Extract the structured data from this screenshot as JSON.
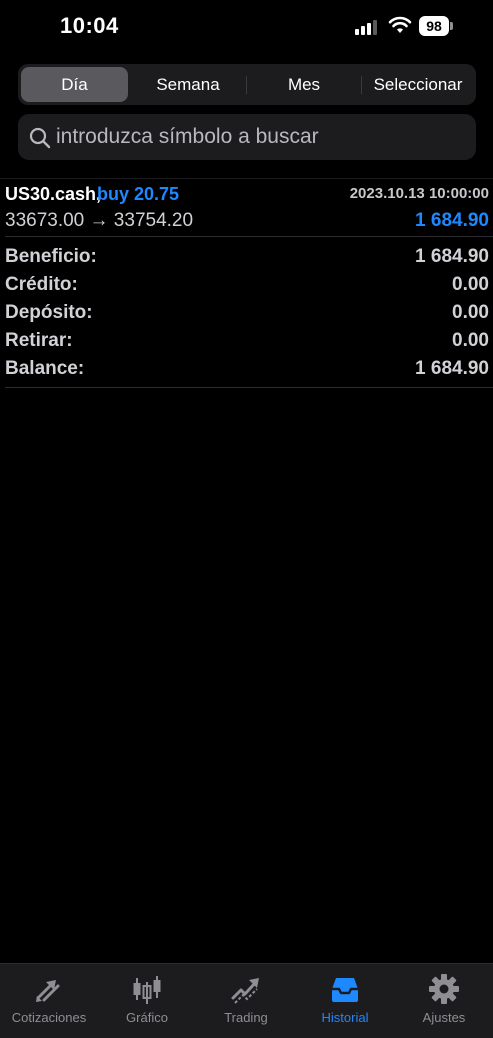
{
  "status_bar": {
    "time": "10:04",
    "battery": "98"
  },
  "period_selector": {
    "options": [
      "Día",
      "Semana",
      "Mes",
      "Seleccionar"
    ],
    "selected": "Día"
  },
  "search": {
    "placeholder": "introduzca símbolo a buscar",
    "value": ""
  },
  "trade": {
    "symbol": "US30.cash,",
    "side": "buy 20.75",
    "datetime": "2023.10.13 10:00:00",
    "prices": "33673.00 → 33754.20",
    "profit": "1 684.90"
  },
  "summary": [
    {
      "label": "Beneficio:",
      "value": "1 684.90"
    },
    {
      "label": "Crédito:",
      "value": "0.00"
    },
    {
      "label": "Depósito:",
      "value": "0.00"
    },
    {
      "label": "Retirar:",
      "value": "0.00"
    },
    {
      "label": "Balance:",
      "value": "1 684.90"
    }
  ],
  "tabbar": {
    "tabs": [
      {
        "label": "Cotizaciones",
        "icon": "quotes-arrows-icon"
      },
      {
        "label": "Gráfico",
        "icon": "candlestick-chart-icon"
      },
      {
        "label": "Trading",
        "icon": "trading-arrow-icon"
      },
      {
        "label": "Historial",
        "icon": "history-inbox-icon"
      },
      {
        "label": "Ajustes",
        "icon": "gear-icon"
      }
    ],
    "active": "Historial"
  },
  "colors": {
    "accent": "#1e88ff",
    "background": "#000000",
    "surface": "#1c1c1e",
    "segment_active": "#5a5a5e",
    "inactive_tab": "#8e8e93"
  }
}
